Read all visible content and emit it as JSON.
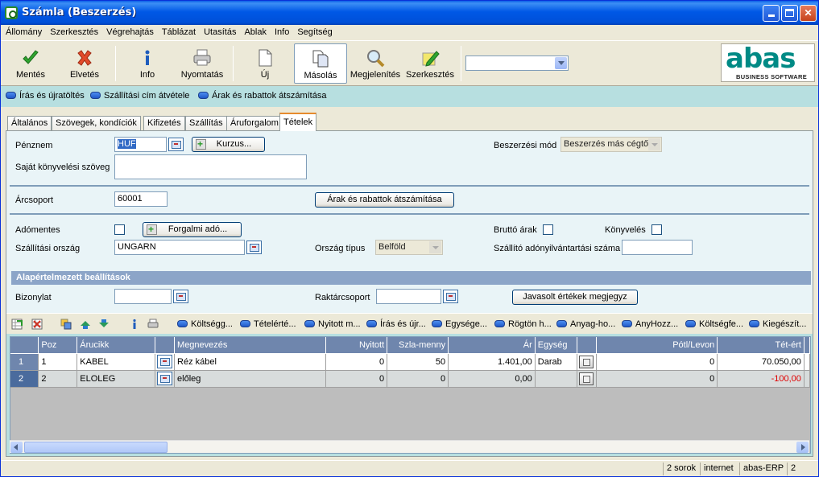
{
  "window": {
    "title": "Számla (Beszerzés)"
  },
  "menu": [
    "Állomány",
    "Szerkesztés",
    "Végrehajtás",
    "Táblázat",
    "Utasítás",
    "Ablak",
    "Info",
    "Segítség"
  ],
  "toolbar": {
    "save": "Mentés",
    "discard": "Elvetés",
    "info": "Info",
    "print": "Nyomtatás",
    "new": "Új",
    "copy": "Másolás",
    "view": "Megjelenítés",
    "edit": "Szerkesztés",
    "combo_value": ""
  },
  "logo": {
    "word": "abas",
    "sub": "BUSINESS SOFTWARE"
  },
  "actions": [
    "Írás és újratöltés",
    "Szállítási cím átvétele",
    "Árak és rabattok átszámítása"
  ],
  "tabs": [
    "Általános",
    "Szövegek, kondíciók",
    "Kifizetés",
    "Szállítás",
    "Áruforgalom",
    "Tételek"
  ],
  "form": {
    "currency_label": "Pénznem",
    "currency_value": "HUF",
    "rate_button": "Kurzus...",
    "purchase_mode_label": "Beszerzési mód",
    "purchase_mode_value": "Beszerzés más cégtő",
    "own_text_label": "Saját könyvelési szöveg",
    "own_text_value": "",
    "price_group_label": "Árcsoport",
    "price_group_value": "60001",
    "recalc_button": "Árak és rabattok átszámítása",
    "tax_exempt_label": "Adómentes",
    "sales_tax_button": "Forgalmi adó...",
    "gross_label": "Bruttó árak",
    "posting_label": "Könyvelés",
    "ship_country_label": "Szállítási ország",
    "ship_country_value": "UNGARN",
    "country_type_label": "Ország típus",
    "country_type_value": "Belföld",
    "supplier_tax_label": "Szállító adónyilvántartási száma",
    "supplier_tax_value": "",
    "defaults_header": "Alapértelmezett beállítások",
    "voucher_label": "Bizonylat",
    "voucher_value": "",
    "warehouse_label": "Raktárcsoport",
    "warehouse_value": "",
    "remember_button": "Javasolt értékek megjegyz"
  },
  "grid_toolbar": [
    "Költségg...",
    "Tételérté...",
    "Nyitott m...",
    "Írás és újr...",
    "Egysége...",
    "Rögtön h...",
    "Anyag-ho...",
    "AnyHozz...",
    "Költségfe...",
    "Kiegészít..."
  ],
  "table": {
    "columns": [
      "Poz",
      "Árucikk",
      "",
      "Megnevezés",
      "Nyitott",
      "Szla-menny",
      "Ár",
      "Egység",
      "",
      "Pótl/Levon",
      "Tét-ért"
    ],
    "rows": [
      {
        "num": "1",
        "poz": "1",
        "item": "KABEL",
        "name": "Réz kábel",
        "open": "0",
        "qty": "50",
        "price": "1.401,00",
        "unit": "Darab",
        "surcharge": "0",
        "value": "70.050,00"
      },
      {
        "num": "2",
        "poz": "2",
        "item": "ELOLEG",
        "name": "előleg",
        "open": "0",
        "qty": "0",
        "price": "0,00",
        "unit": "",
        "surcharge": "0",
        "value": "-100,00"
      }
    ]
  },
  "status": {
    "rows": "2 sorok",
    "mode": "internet",
    "app": "abas-ERP",
    "num": "2"
  }
}
